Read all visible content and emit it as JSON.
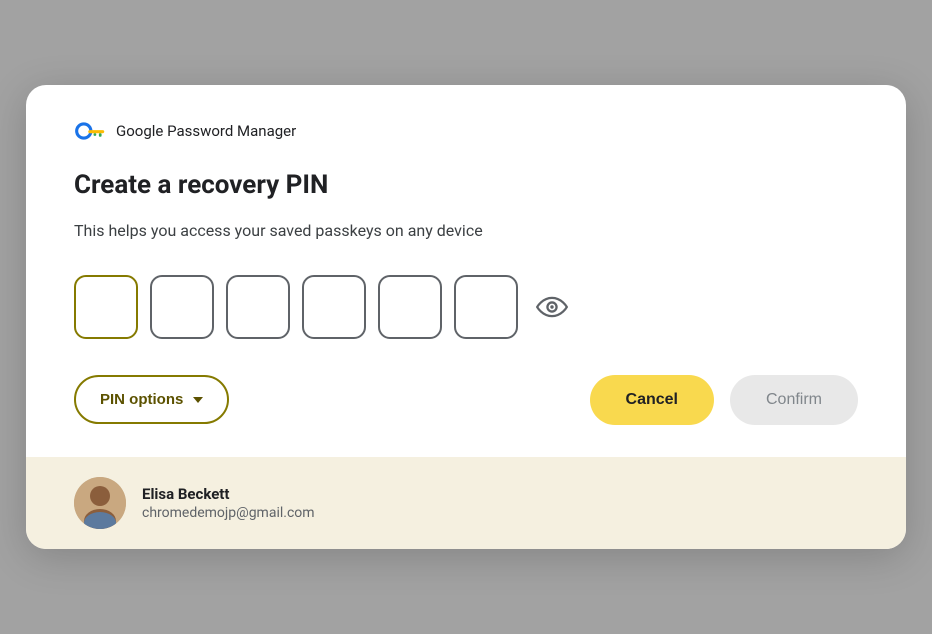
{
  "dialog": {
    "app_name": "Google Password Manager",
    "title": "Create a recovery PIN",
    "subtitle": "This helps you access your saved passkeys on any device",
    "pin_boxes": [
      "",
      "",
      "",
      "",
      "",
      ""
    ],
    "eye_icon_label": "toggle-visibility",
    "actions": {
      "pin_options_label": "PIN options",
      "cancel_label": "Cancel",
      "confirm_label": "Confirm"
    }
  },
  "user": {
    "name": "Elisa Beckett",
    "email": "chromedemojp@gmail.com"
  },
  "colors": {
    "pin_options_border": "#857a00",
    "cancel_bg": "#f9d94e",
    "confirm_bg": "#e8e8e8",
    "confirm_text": "#80868b",
    "footer_bg": "#f5f0e0"
  }
}
